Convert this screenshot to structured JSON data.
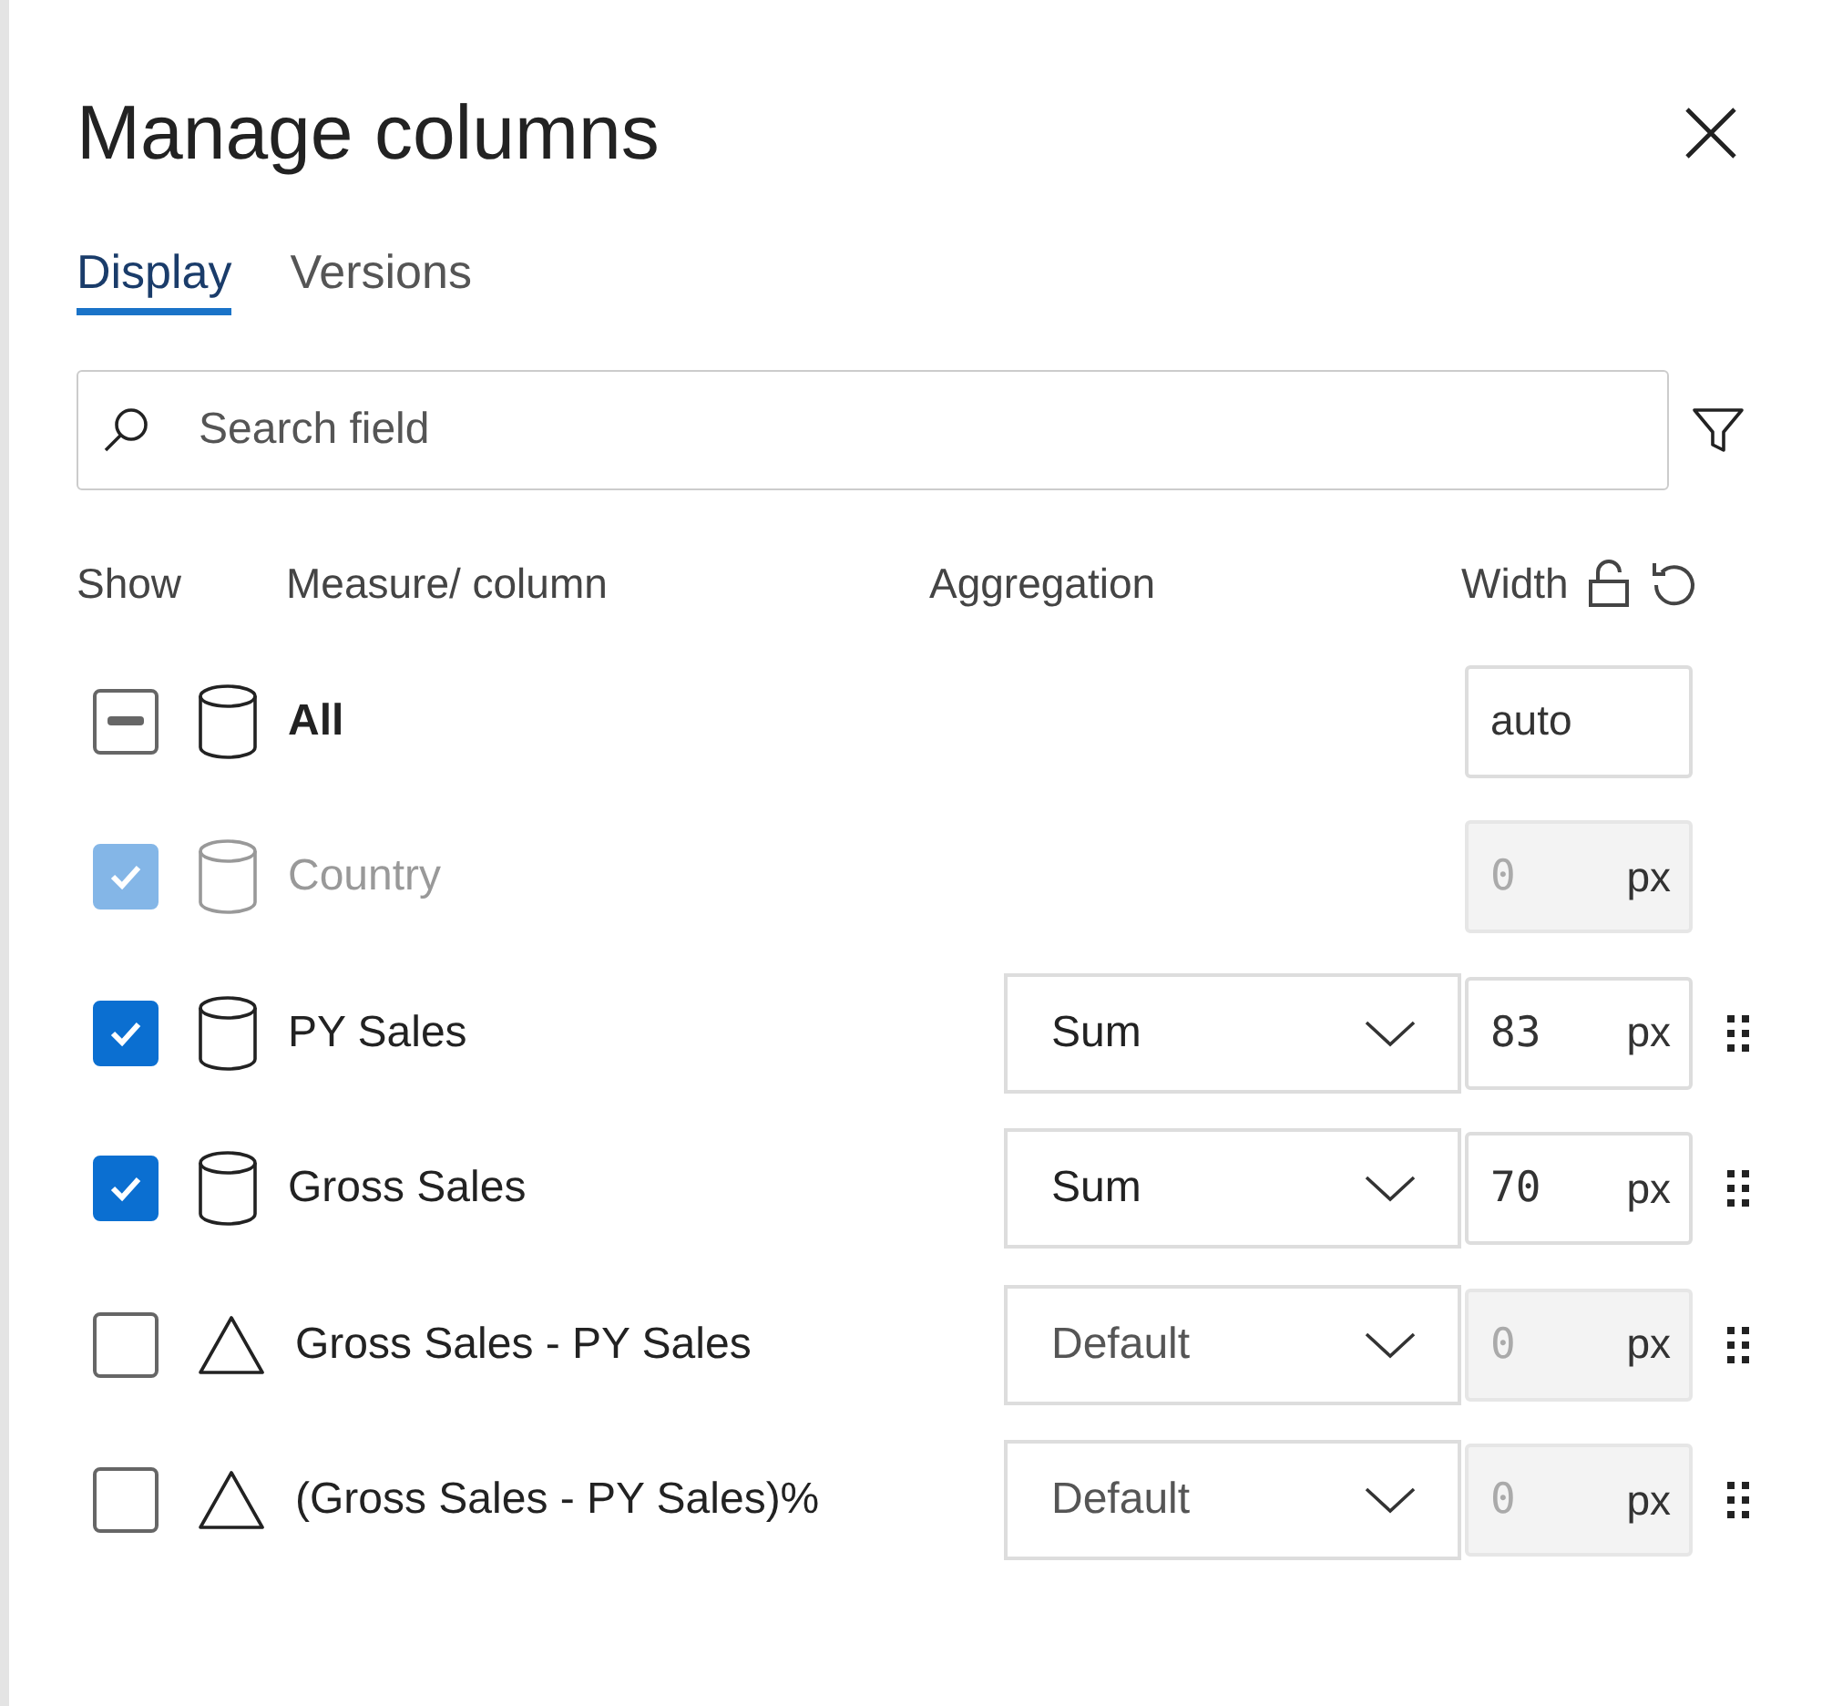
{
  "dialog": {
    "title": "Manage columns"
  },
  "tabs": [
    {
      "label": "Display",
      "selected": true
    },
    {
      "label": "Versions",
      "selected": false
    }
  ],
  "search": {
    "placeholder": "Search field"
  },
  "headers": {
    "show": "Show",
    "column": "Measure/ column",
    "aggregation": "Aggregation",
    "width": "Width"
  },
  "rows": [
    {
      "kind": "all",
      "label": "All",
      "checked": false,
      "indeterminate": true,
      "disabled": false,
      "draggable": false,
      "width": {
        "value": "auto",
        "disabled": false
      }
    },
    {
      "kind": "measure",
      "label": "Country",
      "checked": true,
      "indeterminate": false,
      "disabled": true,
      "draggable": false,
      "width": {
        "value": "0",
        "unit": "px",
        "disabled": true
      }
    },
    {
      "kind": "measure",
      "label": "PY Sales",
      "checked": true,
      "indeterminate": false,
      "disabled": false,
      "draggable": true,
      "aggregation": {
        "value": "Sum"
      },
      "width": {
        "value": "83",
        "unit": "px",
        "disabled": false
      }
    },
    {
      "kind": "measure",
      "label": "Gross Sales",
      "checked": true,
      "indeterminate": false,
      "disabled": false,
      "draggable": true,
      "aggregation": {
        "value": "Sum"
      },
      "width": {
        "value": "70",
        "unit": "px",
        "disabled": false
      }
    },
    {
      "kind": "calculated",
      "label": "Gross Sales - PY Sales",
      "checked": false,
      "indeterminate": false,
      "disabled": false,
      "draggable": true,
      "aggregation": {
        "placeholder": "Default"
      },
      "width": {
        "value": "0",
        "unit": "px",
        "disabled": true
      }
    },
    {
      "kind": "calculated",
      "label": "(Gross Sales - PY Sales)%",
      "checked": false,
      "indeterminate": false,
      "disabled": false,
      "draggable": true,
      "aggregation": {
        "placeholder": "Default"
      },
      "width": {
        "value": "0",
        "unit": "px",
        "disabled": true
      }
    }
  ]
}
